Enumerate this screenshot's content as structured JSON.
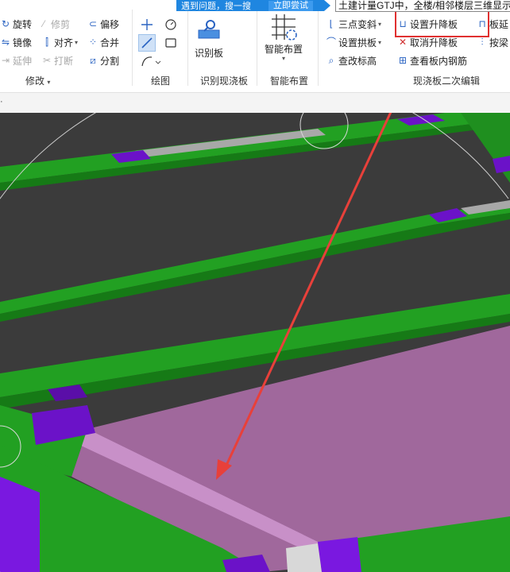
{
  "tooltip": {
    "message": "遇到问题，搜一搜",
    "action": "立即尝试"
  },
  "search_bar": {
    "value": "土建计量GTJ中，全楼/相邻楼层三维显示"
  },
  "modify_group": {
    "label": "修改",
    "rotate": "旋转",
    "trim": "修剪",
    "offset": "偏移",
    "mirror": "镜像",
    "align": "对齐",
    "merge": "合并",
    "extend": "延伸",
    "break": "打断",
    "split": "分割"
  },
  "draw_group": {
    "label": "绘图"
  },
  "identify_group": {
    "label": "识别现浇板",
    "identify_button": "识别板"
  },
  "smart_group": {
    "label": "智能布置",
    "smart_button": "智能布置"
  },
  "edit_group": {
    "label": "现浇板二次编辑",
    "three_point_slope": "三点变斜",
    "set_arch_slab": "设置拱板",
    "check_elevation": "查改标高",
    "set_raise_lower_slab": "设置升降板",
    "cancel_raise_lower_slab": "取消升降板",
    "view_slab_rebar": "查看板内钢筋",
    "slab_extend": "板延",
    "by_beam": "按梁"
  },
  "colors": {
    "viewport_bg": "#3b3b3b",
    "beam_green": "#22a022",
    "column_purple": "#6b12c8",
    "slab_pink": "#a0689c",
    "arrow_red": "#e8403a",
    "highlight_red": "#e03030",
    "tooltip_blue": "#1f86e0"
  }
}
